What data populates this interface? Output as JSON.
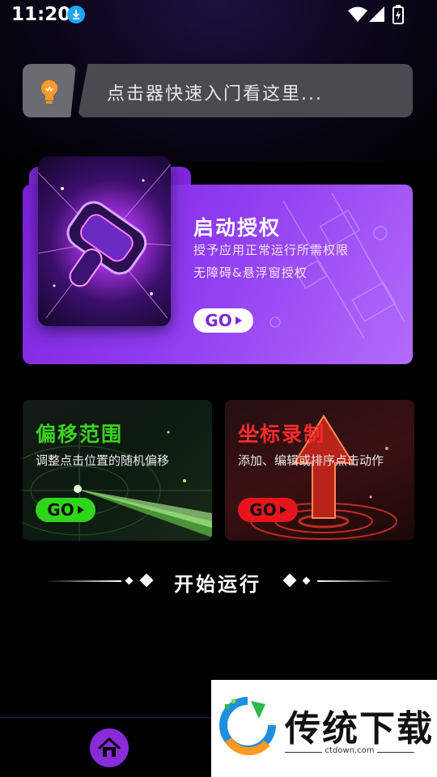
{
  "status_bar": {
    "time": "11:20",
    "icons": [
      "download-icon",
      "wifi-icon",
      "signal-icon",
      "battery-charging-icon"
    ]
  },
  "tip": {
    "icon": "lightbulb-icon",
    "text": "点击器快速入门看这里..."
  },
  "authorize_card": {
    "title": "启动授权",
    "line1": "授予应用正常运行所需权限",
    "line2": "无障碍&悬浮窗授权",
    "go_label": "GO",
    "accent": "#8f3bf0"
  },
  "offset_card": {
    "title": "偏移范围",
    "description": "调整点击位置的随机偏移",
    "go_label": "GO",
    "accent": "#3bd21f"
  },
  "record_card": {
    "title": "坐标录制",
    "description": "添加、编辑或排序点击动作",
    "go_label": "GO",
    "accent": "#ff2a2a"
  },
  "start": {
    "label": "开始运行"
  },
  "bottom_nav": {
    "home_icon": "home-icon",
    "accent": "#8a2bd8"
  },
  "watermark": {
    "text": "传统下载",
    "url": "ctdown.com"
  }
}
